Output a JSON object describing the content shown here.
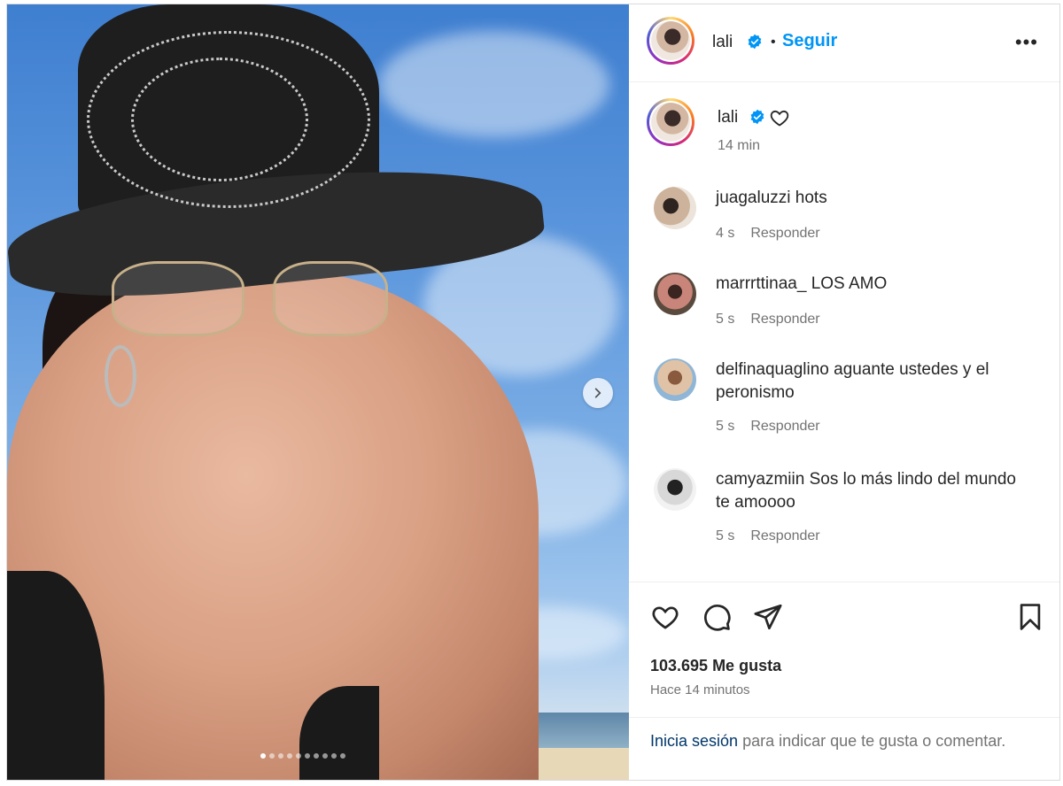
{
  "post": {
    "author": "lali",
    "verified": true,
    "separator": "•",
    "follow_label": "Seguir",
    "more_label": "•••",
    "caption_time": "14 min",
    "carousel": {
      "current_index": 1,
      "total": 10
    }
  },
  "comments": [
    {
      "user": "juagaluzzi",
      "text": "hots",
      "time": "4 s",
      "reply_label": "Responder"
    },
    {
      "user": "marrrttinaa_",
      "text": "LOS AMO",
      "time": "5 s",
      "reply_label": "Responder"
    },
    {
      "user": "delfinaquaglino",
      "text": "aguante ustedes y el peronismo",
      "time": "5 s",
      "reply_label": "Responder"
    },
    {
      "user": "camyazmiin",
      "text": "Sos lo más lindo del mundo te amoooo",
      "time": "5 s",
      "reply_label": "Responder"
    }
  ],
  "stats": {
    "likes": "103.695 Me gusta",
    "time_ago": "Hace 14 minutos"
  },
  "login_prompt": {
    "link": "Inicia sesión",
    "text": " para indicar que te gusta o comentar."
  },
  "icons": {
    "verified": "verified-badge-icon",
    "heart": "heart-icon",
    "comment": "comment-icon",
    "share": "share-icon",
    "save": "bookmark-icon",
    "next": "chevron-right-icon"
  },
  "colors": {
    "accent": "#0095f6",
    "verified": "#0095f6",
    "text": "#262626",
    "muted": "#737373"
  }
}
